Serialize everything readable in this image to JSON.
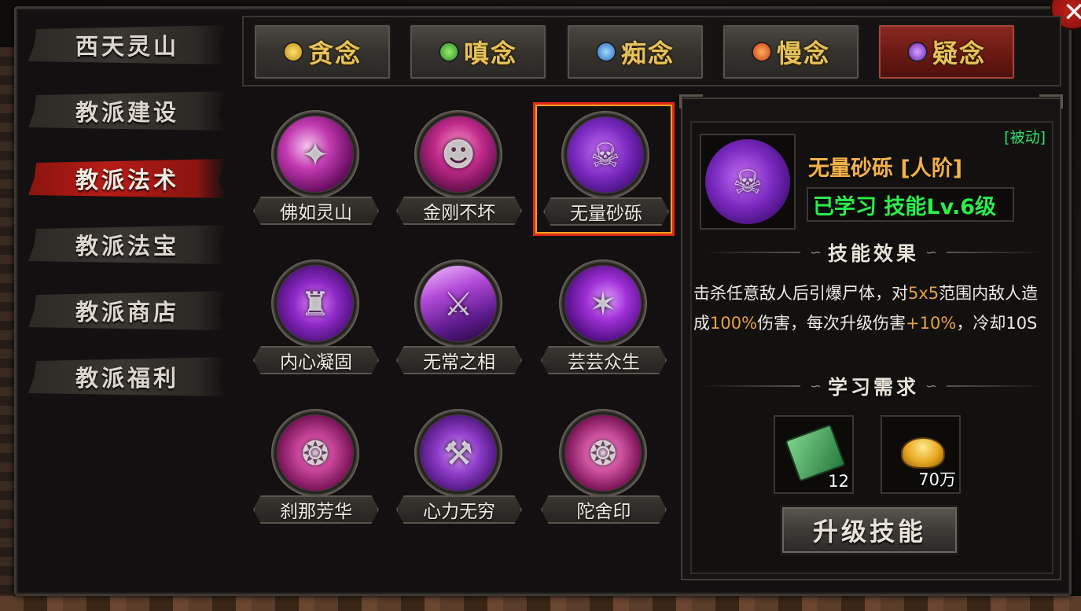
{
  "sidebar": {
    "items": [
      {
        "label": "西天灵山"
      },
      {
        "label": "教派建设"
      },
      {
        "label": "教派法术"
      },
      {
        "label": "教派法宝"
      },
      {
        "label": "教派商店"
      },
      {
        "label": "教派福利"
      }
    ],
    "active_index": 2
  },
  "tabs": [
    {
      "label": "贪念",
      "gem_color": "#e6b21a"
    },
    {
      "label": "嗔念",
      "gem_color": "#3aa83a"
    },
    {
      "label": "痴念",
      "gem_color": "#3a8ad8"
    },
    {
      "label": "慢念",
      "gem_color": "#e05a18"
    },
    {
      "label": "疑念",
      "gem_color": "#8a3ac8"
    }
  ],
  "active_tab_index": 4,
  "skills": [
    {
      "name": "佛如灵山",
      "icon": "burst-icon"
    },
    {
      "name": "金刚不坏",
      "icon": "guardian-icon"
    },
    {
      "name": "无量砂砾",
      "icon": "skulls-icon"
    },
    {
      "name": "内心凝固",
      "icon": "golem-icon"
    },
    {
      "name": "无常之相",
      "icon": "swords-rain-icon"
    },
    {
      "name": "芸芸众生",
      "icon": "claw-icon"
    },
    {
      "name": "刹那芳华",
      "icon": "sigil-icon"
    },
    {
      "name": "心力无穷",
      "icon": "hammer-icon"
    },
    {
      "name": "陀舍印",
      "icon": "seal-icon"
    }
  ],
  "selected_skill_index": 2,
  "detail": {
    "type_tag": "[被动]",
    "title": "无量砂砾 [人阶]",
    "level_text": "已学习 技能Lv.6级",
    "effect_heading": "技能效果",
    "desc": {
      "p1": "击杀任意敌人后引爆尸体，对",
      "v1": "5x5",
      "p2": "范围内敌人造成",
      "v2": "100%",
      "p3": "伤害，每次升级伤害",
      "v3": "+10%",
      "p4": "，冷却10S"
    },
    "req_heading": "学习需求",
    "requirements": [
      {
        "icon": "skill-book-icon",
        "qty": "12"
      },
      {
        "icon": "gold-ingot-icon",
        "qty": "70万"
      }
    ],
    "upgrade_label": "升级技能"
  },
  "colors": {
    "accent_red": "#b81c16",
    "gold_text": "#e6c25a",
    "green_text": "#2aee4a",
    "highlight_orange": "#e8a040"
  }
}
